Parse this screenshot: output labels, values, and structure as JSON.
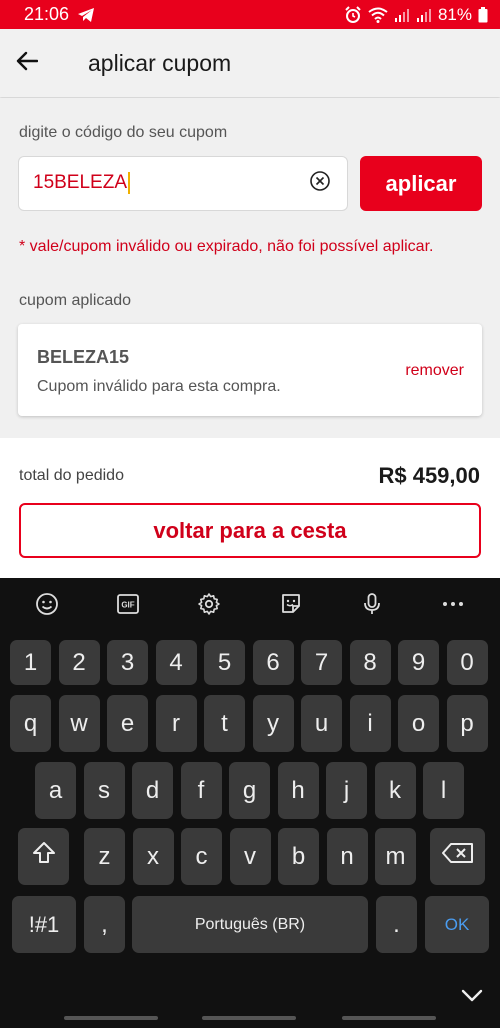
{
  "status_bar": {
    "time": "21:06",
    "battery": "81%"
  },
  "app_bar": {
    "title": "aplicar cupom"
  },
  "coupon": {
    "field_label": "digite o código do seu cupom",
    "value": "15BELEZA",
    "apply_label": "aplicar",
    "error": "* vale/cupom inválido ou expirado, não foi possível aplicar."
  },
  "applied": {
    "section_label": "cupom aplicado",
    "code": "BELEZA15",
    "description": "Cupom inválido para esta compra.",
    "remove_label": "remover"
  },
  "footer": {
    "total_label": "total do pedido",
    "total_value": "R$ 459,00",
    "back_label": "voltar para a cesta"
  },
  "keyboard": {
    "toolbar": [
      "emoji-icon",
      "gif-icon",
      "settings-icon",
      "sticker-icon",
      "microphone-icon",
      "more-icon"
    ],
    "gif_text": "GIF",
    "row_numbers": [
      "1",
      "2",
      "3",
      "4",
      "5",
      "6",
      "7",
      "8",
      "9",
      "0"
    ],
    "row_1": [
      "q",
      "w",
      "e",
      "r",
      "t",
      "y",
      "u",
      "i",
      "o",
      "p"
    ],
    "row_2": [
      "a",
      "s",
      "d",
      "f",
      "g",
      "h",
      "j",
      "k",
      "l"
    ],
    "row_3": [
      "z",
      "x",
      "c",
      "v",
      "b",
      "n",
      "m"
    ],
    "symbols_label": "!#1",
    "comma_label": ",",
    "space_label": "Português (BR)",
    "period_label": ".",
    "ok_label": "OK"
  },
  "colors": {
    "brand": "#e8001c",
    "error": "#d0001a"
  }
}
